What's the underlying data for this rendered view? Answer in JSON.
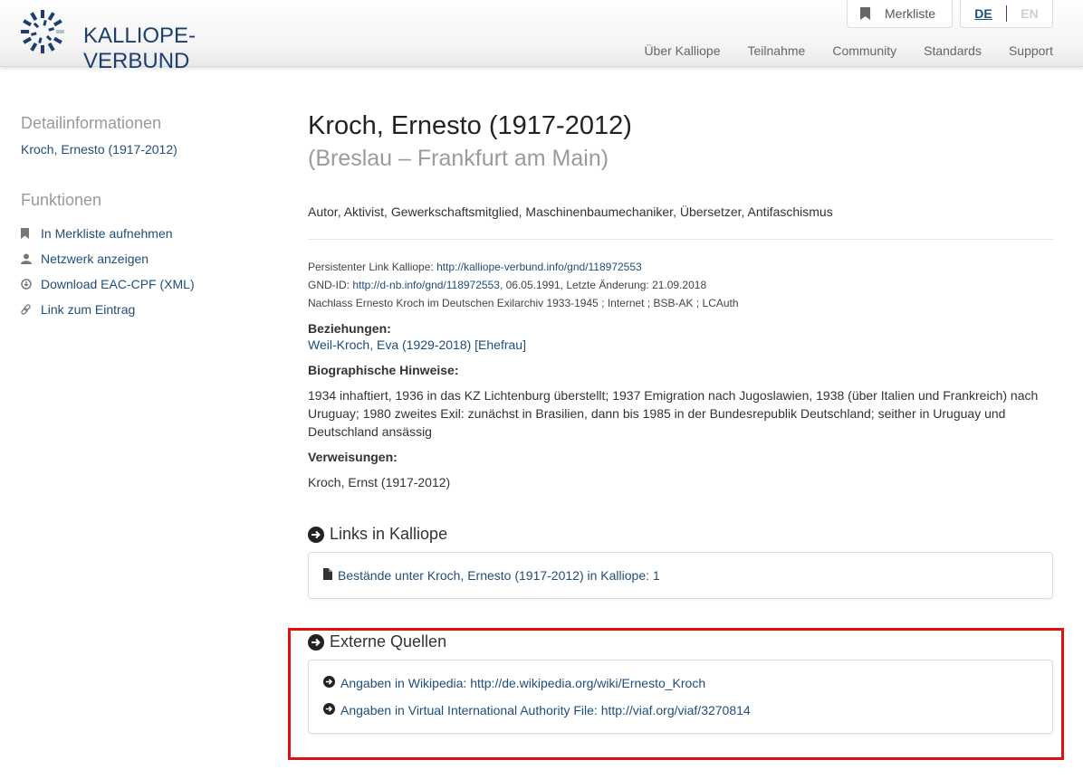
{
  "header": {
    "logo_text": "KALLIOPE-VERBUND",
    "merkliste_label": "Merkliste",
    "lang_de": "DE",
    "lang_en": "EN",
    "nav": [
      "Über Kalliope",
      "Teilnahme",
      "Community",
      "Standards",
      "Support"
    ]
  },
  "sidebar": {
    "detail_heading": "Detailinformationen",
    "detail_person": "Kroch, Ernesto (1917-2012)",
    "functions_heading": "Funktionen",
    "functions": [
      {
        "label": "In Merkliste aufnehmen",
        "icon": "bookmark-icon"
      },
      {
        "label": "Netzwerk anzeigen",
        "icon": "user-icon"
      },
      {
        "label": "Download EAC-CPF (XML)",
        "icon": "download-icon"
      },
      {
        "label": "Link zum Eintrag",
        "icon": "link-icon"
      }
    ]
  },
  "main": {
    "title": "Kroch, Ernesto (1917-2012)",
    "subtitle": "(Breslau – Frankfurt am Main)",
    "occupations": "Autor, Aktivist, Gewerkschaftsmitglied, Maschinenbaumechaniker, Übersetzer, Antifaschismus",
    "persistent_link_label": "Persistenter Link Kalliope: ",
    "persistent_link_url": "http://kalliope-verbund.info/gnd/118972553",
    "gnd_label": "GND-ID: ",
    "gnd_url": "http://d-nb.info/gnd/118972553",
    "gnd_suffix": ", 06.05.1991, Letzte Änderung: 21.09.2018",
    "sources_line": "Nachlass Ernesto Kroch im Deutschen Exilarchiv 1933-1945 ; Internet ; BSB-AK ; LCAuth",
    "relations_label": "Beziehungen:",
    "relation_link": "Weil-Kroch, Eva (1929-2018) [Ehefrau]",
    "bio_label": "Biographische Hinweise:",
    "bio_text": "1934 inhaftiert, 1936 in das KZ Lichtenburg überstellt; 1937 Emigration nach Jugoslawien, 1938 (über Italien und Frankreich) nach Uruguay; 1980 zweites Exil: zunächst in Brasilien, dann bis 1985 in der Bundesrepublik Deutschland; seither in Uruguay und Deutschland ansässig",
    "refs_label": "Verweisungen:",
    "refs_text": "Kroch, Ernst (1917-2012)",
    "links_heading": "Links in Kalliope",
    "links_item": "Bestände unter Kroch, Ernesto (1917-2012) in Kalliope: 1",
    "external_heading": "Externe Quellen",
    "external_items": [
      "Angaben in Wikipedia: http://de.wikipedia.org/wiki/Ernesto_Kroch",
      "Angaben in Virtual International Authority File: http://viaf.org/viaf/3270814"
    ]
  },
  "colors": {
    "link": "#1f4e79",
    "logo": "#1c3f6e",
    "highlight": "#e01010"
  }
}
